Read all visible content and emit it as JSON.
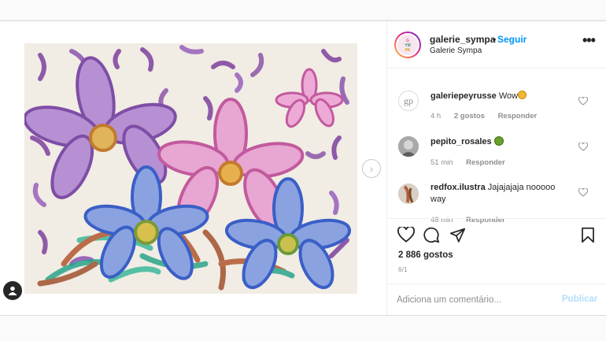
{
  "header": {
    "username": "galerie_sympa",
    "separator": "•",
    "follow_label": "Seguir",
    "subtitle": "Galerie Sympa",
    "avatar_text": "G YM PA",
    "more_icon": "more-horizontal-icon"
  },
  "comments": [
    {
      "user": "galeriepeyrusse",
      "text": "Wow",
      "emoji": "clapping-hands-icon",
      "time": "4 h",
      "likes": "2 gostos",
      "reply": "Responder",
      "avatar_text": "gp"
    },
    {
      "user": "pepito_rosales",
      "text": "",
      "emoji": "face-icon",
      "time": "51 min",
      "reply": "Responder"
    },
    {
      "user": "redfox.ilustra",
      "text": "Jajajajaja nooooo way",
      "time": "48 min",
      "reply": "Responder"
    }
  ],
  "actions": {
    "likes": "2 886 gostos",
    "date": "6/1"
  },
  "add_comment": {
    "placeholder": "Adiciona um comentário...",
    "publish_label": "Publicar"
  },
  "colors": {
    "link": "#0095f6",
    "publish_disabled": "#b2dffc",
    "muted": "#8e8e8e"
  }
}
